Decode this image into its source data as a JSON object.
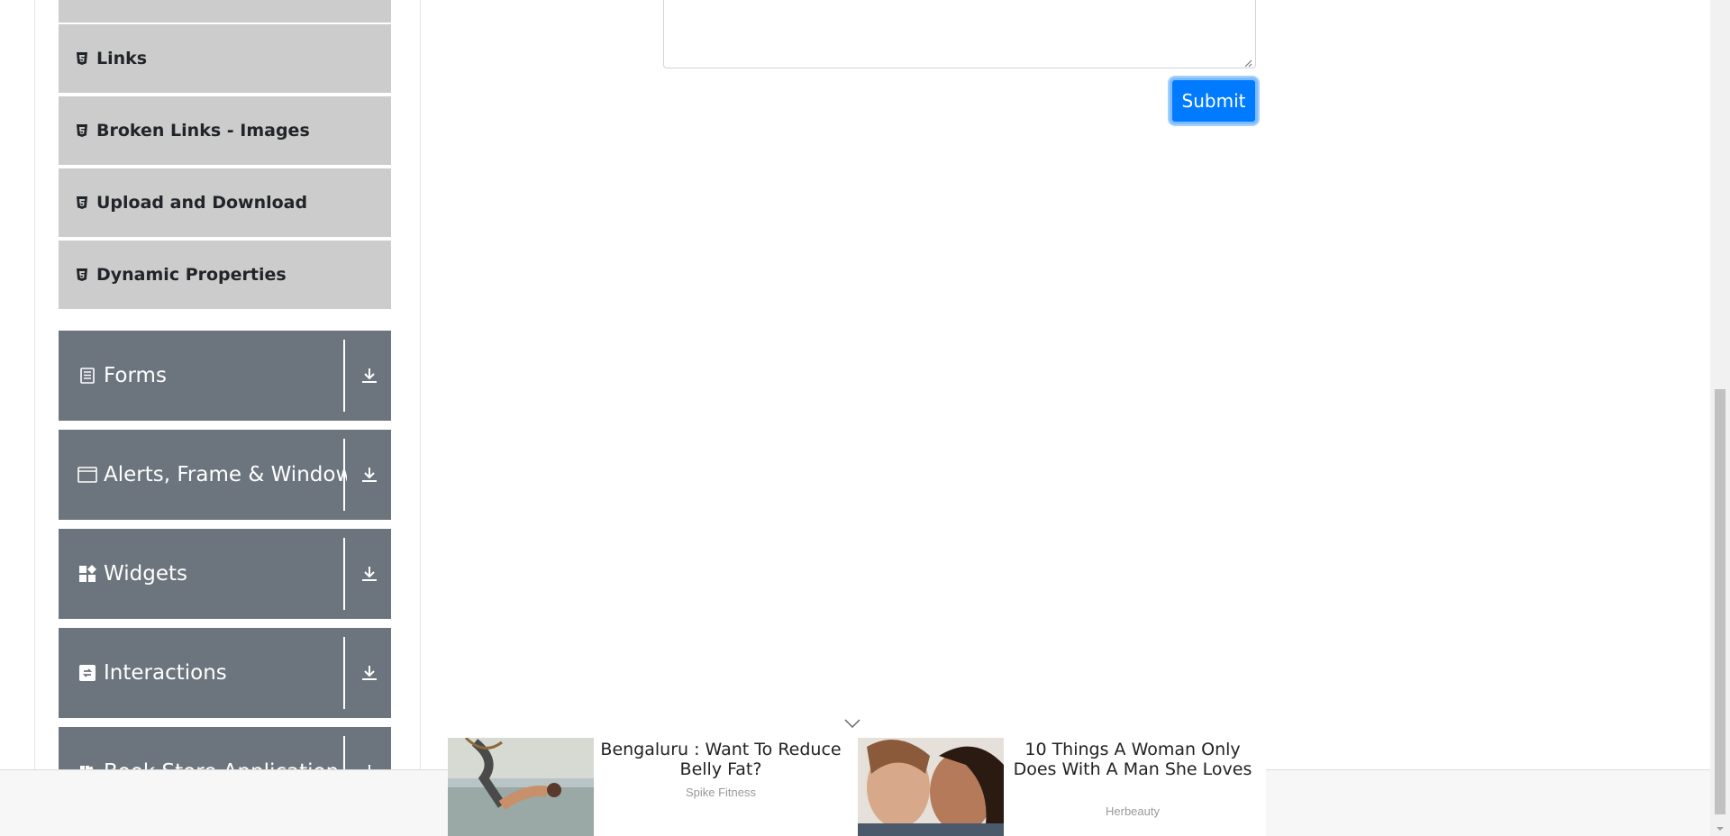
{
  "sidebar": {
    "sub_items": [
      {
        "label": "Links",
        "icon": "html5-icon"
      },
      {
        "label": "Broken Links - Images",
        "icon": "html5-icon"
      },
      {
        "label": "Upload and Download",
        "icon": "html5-icon"
      },
      {
        "label": "Dynamic Properties",
        "icon": "html5-icon"
      }
    ],
    "groups": [
      {
        "label": "Forms",
        "icon": "form-icon"
      },
      {
        "label": "Alerts, Frame & Windows",
        "icon": "window-icon"
      },
      {
        "label": "Widgets",
        "icon": "widgets-icon"
      },
      {
        "label": "Interactions",
        "icon": "interactions-icon"
      },
      {
        "label": "Book Store Application",
        "icon": "book-icon"
      }
    ]
  },
  "form": {
    "submit_label": "Submit"
  },
  "ads": [
    {
      "title": "Bengaluru : Want To Reduce Belly Fat?",
      "source": "Spike Fitness"
    },
    {
      "title": "10 Things A Woman Only Does With A Man She Loves",
      "source": "Herbeauty"
    }
  ],
  "colors": {
    "sub_item_bg": "#cccccc",
    "group_bg": "#6c757d",
    "submit_bg": "#007bff"
  }
}
